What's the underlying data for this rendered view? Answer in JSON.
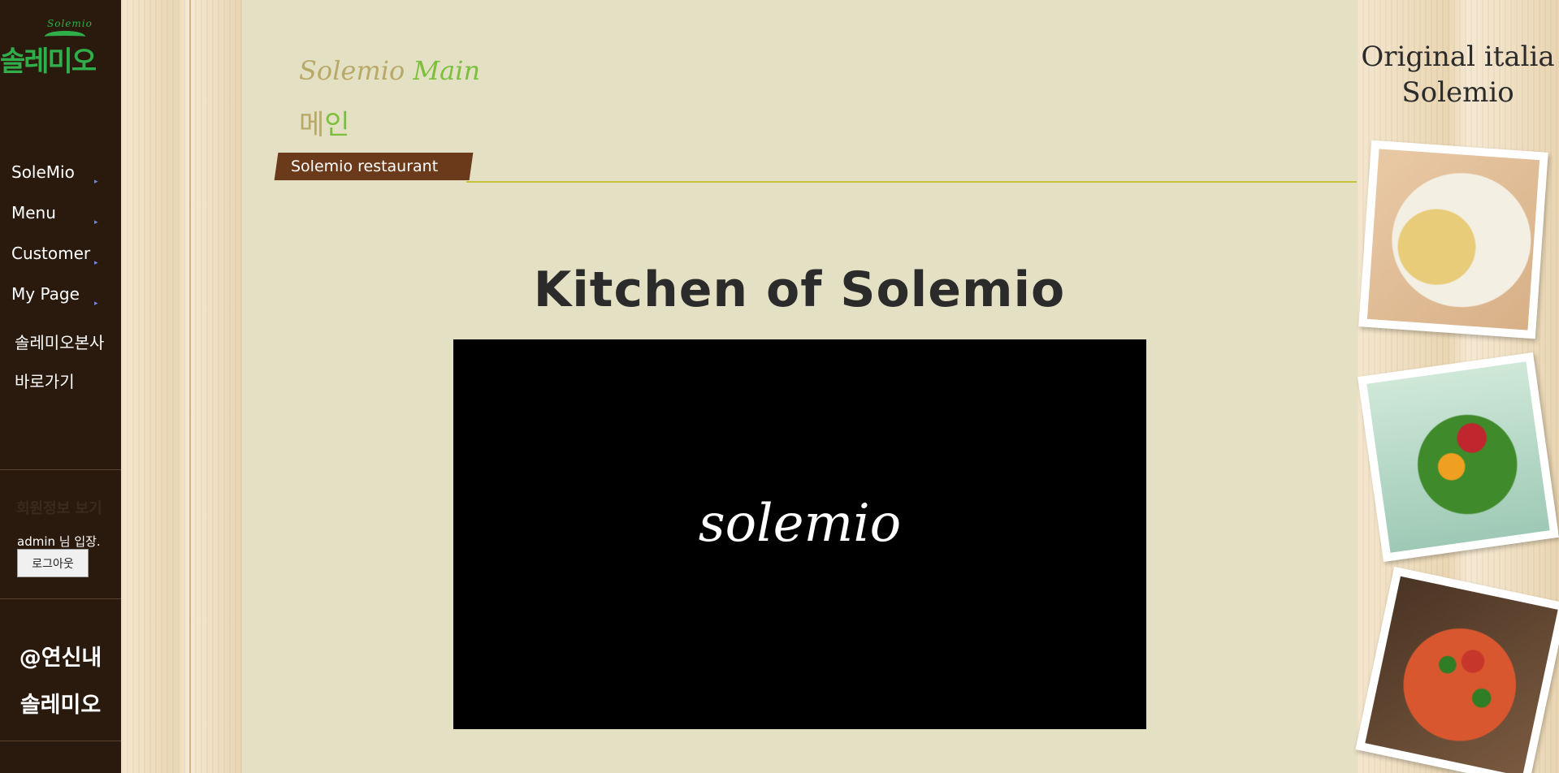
{
  "logo": {
    "small": "Solemio",
    "main": "솔레미오"
  },
  "nav": {
    "items": [
      {
        "label": "SoleMio",
        "arrow": "▸"
      },
      {
        "label": "Menu",
        "arrow": "▸"
      },
      {
        "label": "Customer",
        "arrow": "▸"
      },
      {
        "label": "My Page",
        "arrow": "▸"
      }
    ],
    "hq_link": "솔레미오본사 바로가기"
  },
  "member": {
    "title": "회원정보 보기",
    "status": "admin 님 입장.",
    "logout_label": "로그아웃"
  },
  "sidebar_footer": {
    "line1": "@연신내",
    "line2": "솔레미오"
  },
  "header": {
    "crumb_en_a": "Solemio ",
    "crumb_en_b": "Main",
    "crumb_ko_a": "메",
    "crumb_ko_b": "인",
    "tag": "Solemio restaurant"
  },
  "content": {
    "title": "Kitchen of Solemio",
    "video_label": "solemio"
  },
  "brand": {
    "line1": "Original italia",
    "line2": "Solemio"
  },
  "colors": {
    "sidebar_bg": "#2a1a0e",
    "main_bg": "#e4e0c4",
    "accent_green": "#7cbf3a",
    "ribbon_brown": "#6b3a1a",
    "logo_green": "#2fae4a"
  }
}
